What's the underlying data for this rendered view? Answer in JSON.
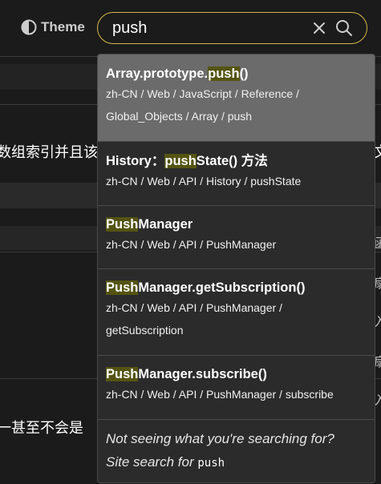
{
  "header": {
    "theme_label": "Theme",
    "search_value": "push",
    "search_placeholder": ""
  },
  "background": {
    "line1_left": "数组索引并且该",
    "line1_right": "文",
    "side_chars": [
      "函",
      "扇",
      "入",
      "扇",
      "入"
    ],
    "line2_left": "一甚至不会是"
  },
  "results": [
    {
      "title_pre": "Array.prototype.",
      "title_hl": "push",
      "title_post": "()",
      "path_line1": "zh-CN / Web / JavaScript / Reference /",
      "path_line2": "Global_Objects / Array / push"
    },
    {
      "title_pre": "History：",
      "title_hl": "push",
      "title_post": "State() 方法",
      "path_line1": "zh-CN / Web / API / History / pushState",
      "path_line2": ""
    },
    {
      "title_pre": "",
      "title_hl": "Push",
      "title_post": "Manager",
      "path_line1": "zh-CN / Web / API / PushManager",
      "path_line2": ""
    },
    {
      "title_pre": "",
      "title_hl": "Push",
      "title_post": "Manager.getSubscription()",
      "path_line1": "zh-CN / Web / API / PushManager /",
      "path_line2": "getSubscription"
    },
    {
      "title_pre": "",
      "title_hl": "Push",
      "title_post": "Manager.subscribe()",
      "path_line1": "zh-CN / Web / API / PushManager / subscribe",
      "path_line2": ""
    }
  ],
  "footer": {
    "not_seeing": "Not seeing what you're searching for?",
    "site_search_label": "Site search for",
    "query": "push"
  }
}
